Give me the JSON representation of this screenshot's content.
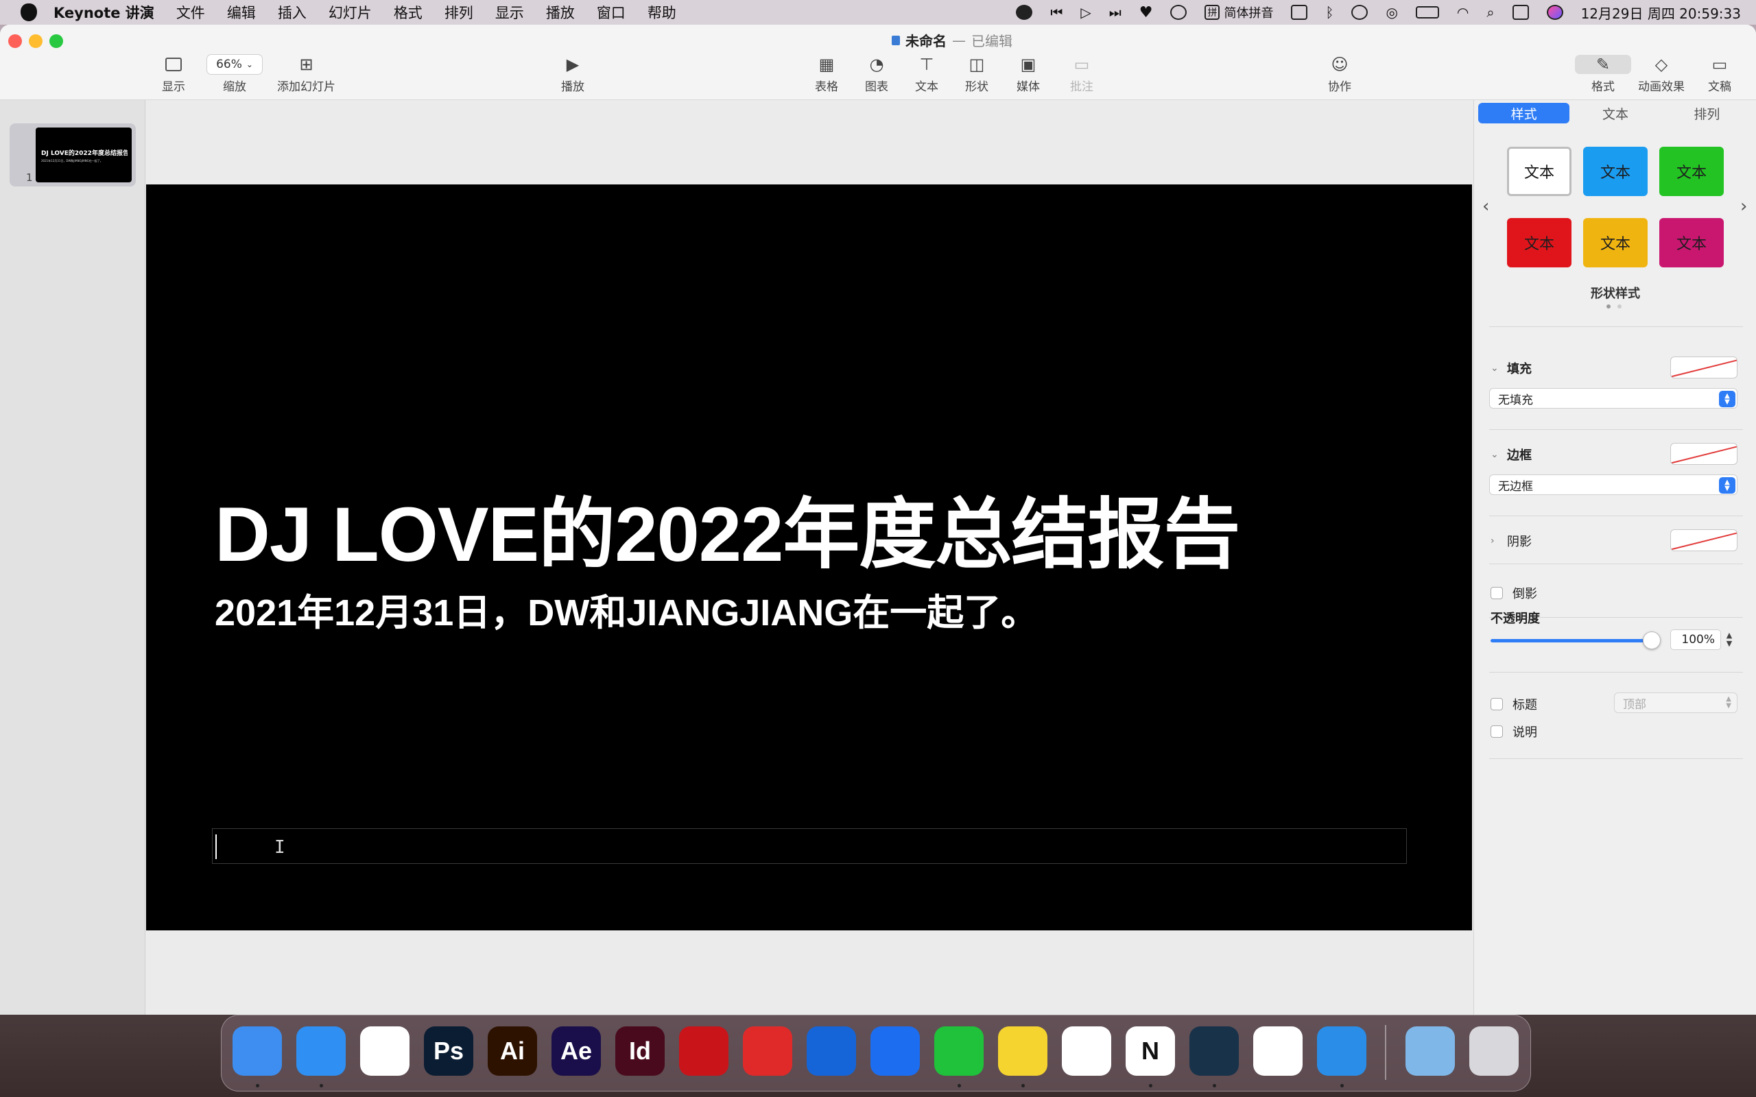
{
  "menubar": {
    "app_name": "Keynote 讲演",
    "menus": [
      "文件",
      "编辑",
      "插入",
      "幻灯片",
      "格式",
      "排列",
      "显示",
      "播放",
      "窗口",
      "帮助"
    ],
    "input_method": "简体拼音",
    "ime_glyph": "拼",
    "datetime": "12月29日 周四  20:59:33"
  },
  "window": {
    "title": "未命名",
    "title_separator": "—",
    "title_status": "已编辑"
  },
  "toolbar": {
    "view_label": "显示",
    "zoom_value": "66%",
    "zoom_label": "缩放",
    "add_slide_label": "添加幻灯片",
    "play_label": "播放",
    "table_label": "表格",
    "chart_label": "图表",
    "text_label": "文本",
    "shape_label": "形状",
    "media_label": "媒体",
    "comment_label": "批注",
    "collaborate_label": "协作",
    "format_label": "格式",
    "animate_label": "动画效果",
    "document_label": "文稿"
  },
  "navigator": {
    "slide_number": "1",
    "thumb_title": "DJ LOVE的2022年度总结报告",
    "thumb_subtitle": "2021年12月31日，DW和JIANGJIANG在一起了。"
  },
  "slide": {
    "title": "DJ LOVE的2022年度总结报告",
    "subtitle": "2021年12月31日，DW和JIANGJIANG在一起了。",
    "background": "#000000"
  },
  "inspector": {
    "tabs": [
      "样式",
      "文本",
      "排列"
    ],
    "active_tab": "样式",
    "swatch_text": "文本",
    "swatch_colors": [
      "#ffffff",
      "#1a9cf0",
      "#22c322",
      "#e0151b",
      "#f0b411",
      "#c9166f"
    ],
    "shape_styles_label": "形状样式",
    "fill_label": "填充",
    "fill_value": "无填充",
    "border_label": "边框",
    "border_value": "无边框",
    "shadow_label": "阴影",
    "reflection_label": "倒影",
    "opacity_label": "不透明度",
    "opacity_value": "100%",
    "opacity_fraction": 1.0,
    "caption_title_label": "标题",
    "caption_position": "顶部",
    "caption_desc_label": "说明"
  },
  "dock": {
    "apps": [
      {
        "name": "finder",
        "label": "",
        "bg": "#3d8ef0"
      },
      {
        "name": "safari",
        "label": "",
        "bg": "#2f8ff2"
      },
      {
        "name": "chrome",
        "label": "",
        "bg": "#ffffff"
      },
      {
        "name": "photoshop",
        "label": "Ps",
        "bg": "#0b1d33"
      },
      {
        "name": "illustrator",
        "label": "Ai",
        "bg": "#2e1200"
      },
      {
        "name": "after-effects",
        "label": "Ae",
        "bg": "#1a0f4a"
      },
      {
        "name": "indesign",
        "label": "Id",
        "bg": "#4a0a1e"
      },
      {
        "name": "acrobat",
        "label": "",
        "bg": "#c9141a"
      },
      {
        "name": "netease-music",
        "label": "",
        "bg": "#e02a2a"
      },
      {
        "name": "browser",
        "label": "",
        "bg": "#1665d8"
      },
      {
        "name": "lark",
        "label": "",
        "bg": "#1d6df0"
      },
      {
        "name": "wechat",
        "label": "",
        "bg": "#1fc23a"
      },
      {
        "name": "qq-music",
        "label": "",
        "bg": "#f6d430"
      },
      {
        "name": "baidu-netdisk",
        "label": "",
        "bg": "#ffffff"
      },
      {
        "name": "notion",
        "label": "N",
        "bg": "#ffffff"
      },
      {
        "name": "cinema4d",
        "label": "",
        "bg": "#18324a"
      },
      {
        "name": "qq",
        "label": "",
        "bg": "#ffffff"
      },
      {
        "name": "keynote",
        "label": "",
        "bg": "#2a8ee8"
      },
      {
        "name": "downloads-folder",
        "label": "",
        "bg": "#7fb8e8"
      },
      {
        "name": "trash",
        "label": "",
        "bg": "#d8d8dc"
      }
    ]
  }
}
